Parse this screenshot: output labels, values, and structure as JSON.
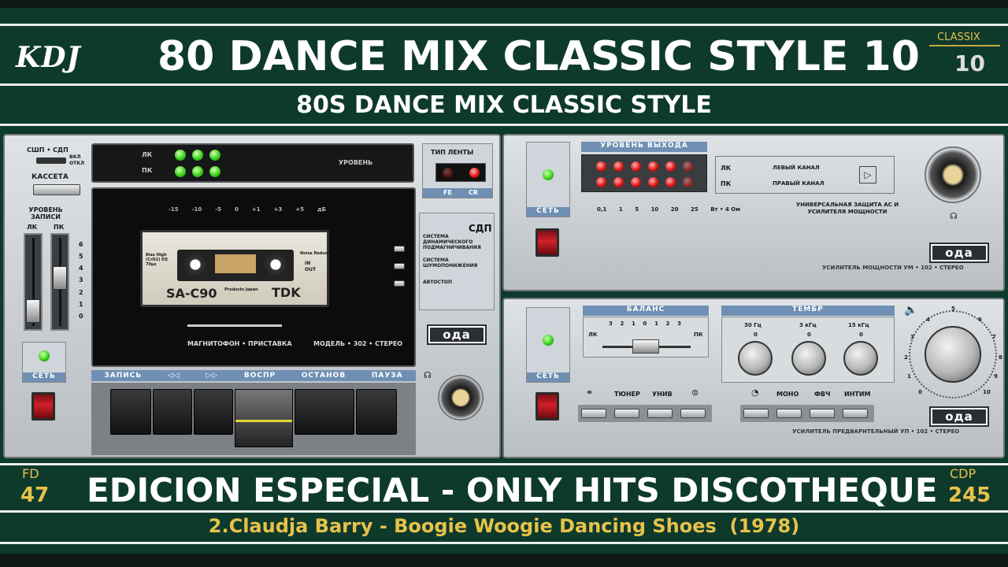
{
  "header": {
    "logo": "KDJ",
    "title": "80 DANCE MIX CLASSIC STYLE 10",
    "subtitle": "80S DANCE MIX CLASSIC STYLE",
    "badge_label": "CLASSIX",
    "badge_value": "10"
  },
  "footer": {
    "left_label": "FD",
    "left_value": "47",
    "right_label": "CDP",
    "right_value": "245",
    "title": "EDICION ESPECIAL - ONLY HITS DISCOTHEQUE",
    "track": "2.Claudja Barry - Boogie Woogie Dancing Shoes  (1978)"
  },
  "deck": {
    "top_switch": "СШП • СДП",
    "switch_states": [
      "ВКЛ",
      "ОТКЛ"
    ],
    "cassette_button": "КАССЕТА",
    "record_level_title": "УРОВЕНЬ ЗАПИСИ",
    "channels": [
      "ЛК",
      "ПК"
    ],
    "slider_scale": [
      "6",
      "5",
      "4",
      "3",
      "2",
      "1",
      "0"
    ],
    "meter_label": "УРОВЕНЬ",
    "meter_scale": [
      "-15",
      "-10",
      "-5",
      "0",
      "+1",
      "+3",
      "+5",
      "дБ"
    ],
    "tape_type_title": "ТИП ЛЕНТЫ",
    "tape_types": [
      "FE",
      "CR"
    ],
    "cassette_brand": "SA-C90",
    "cassette_maker": "TDK",
    "cassette_info_left": "Bias High (CrO2) EQ 70μs",
    "cassette_info_right": "Noise Reduction",
    "cassette_in": "IN",
    "cassette_out": "OUT",
    "cassette_type_note": "Products Japan",
    "model_left": "МАГНИТОФОН • ПРИСТАВКА",
    "model_right": "МОДЕЛЬ • 302 • СТЕРЕО",
    "system1_big": "СДП",
    "system1": "СИСТЕМА ДИНАМИЧЕСКОГО ПОДМАГНИЧИВАНИЯ",
    "system2": "СИСТЕМА ШУМОПОНИЖЕНИЯ",
    "autostop": "АВТОСТОП",
    "power": "СЕТЬ",
    "transport": [
      "ЗАПИСЬ",
      "◁◁",
      "▷▷",
      "ВОСПР",
      "ОСТАНОВ",
      "ПАУЗА"
    ],
    "brand": "ода"
  },
  "amp": {
    "output_title": "УРОВЕНЬ ВЫХОДА",
    "scale": [
      "0,1",
      "1",
      "5",
      "10",
      "20",
      "25",
      "Вт • 4 Ом"
    ],
    "left_channel": "ЛЕВЫЙ КАНАЛ",
    "right_channel": "ПРАВЫЙ КАНАЛ",
    "channels": [
      "ЛК",
      "ПК"
    ],
    "protection": "УНИВЕРСАЛЬНАЯ ЗАЩИТА АС И УСИЛИТЕЛЯ МОЩНОСТИ",
    "power": "СЕТЬ",
    "model": "УСИЛИТЕЛЬ  МОЩНОСТИ  УМ • 102 • СТЕРЕО",
    "brand": "ода"
  },
  "preamp": {
    "balance_title": "БАЛАНС",
    "balance_scale": [
      "3",
      "2",
      "1",
      "0",
      "1",
      "2",
      "3"
    ],
    "balance_left": "ЛК",
    "balance_right": "ПК",
    "timbre_title": "ТЕМБР",
    "timbre_bands": [
      "30 Гц",
      "3 кГц",
      "15 кГц"
    ],
    "timbre_zero": "0",
    "volume_scale": [
      "0",
      "1",
      "2",
      "3",
      "4",
      "5",
      "6",
      "7",
      "8",
      "9",
      "10"
    ],
    "inputs": [
      "ТЮНЕР",
      "УНИВ"
    ],
    "modes": [
      "МОНО",
      "ФВЧ",
      "ИНТИМ"
    ],
    "power": "СЕТЬ",
    "model": "УСИЛИТЕЛЬ  ПРЕДВАРИТЕЛЬНЫЙ  УП • 102 • СТЕРЕО",
    "brand": "ода"
  }
}
